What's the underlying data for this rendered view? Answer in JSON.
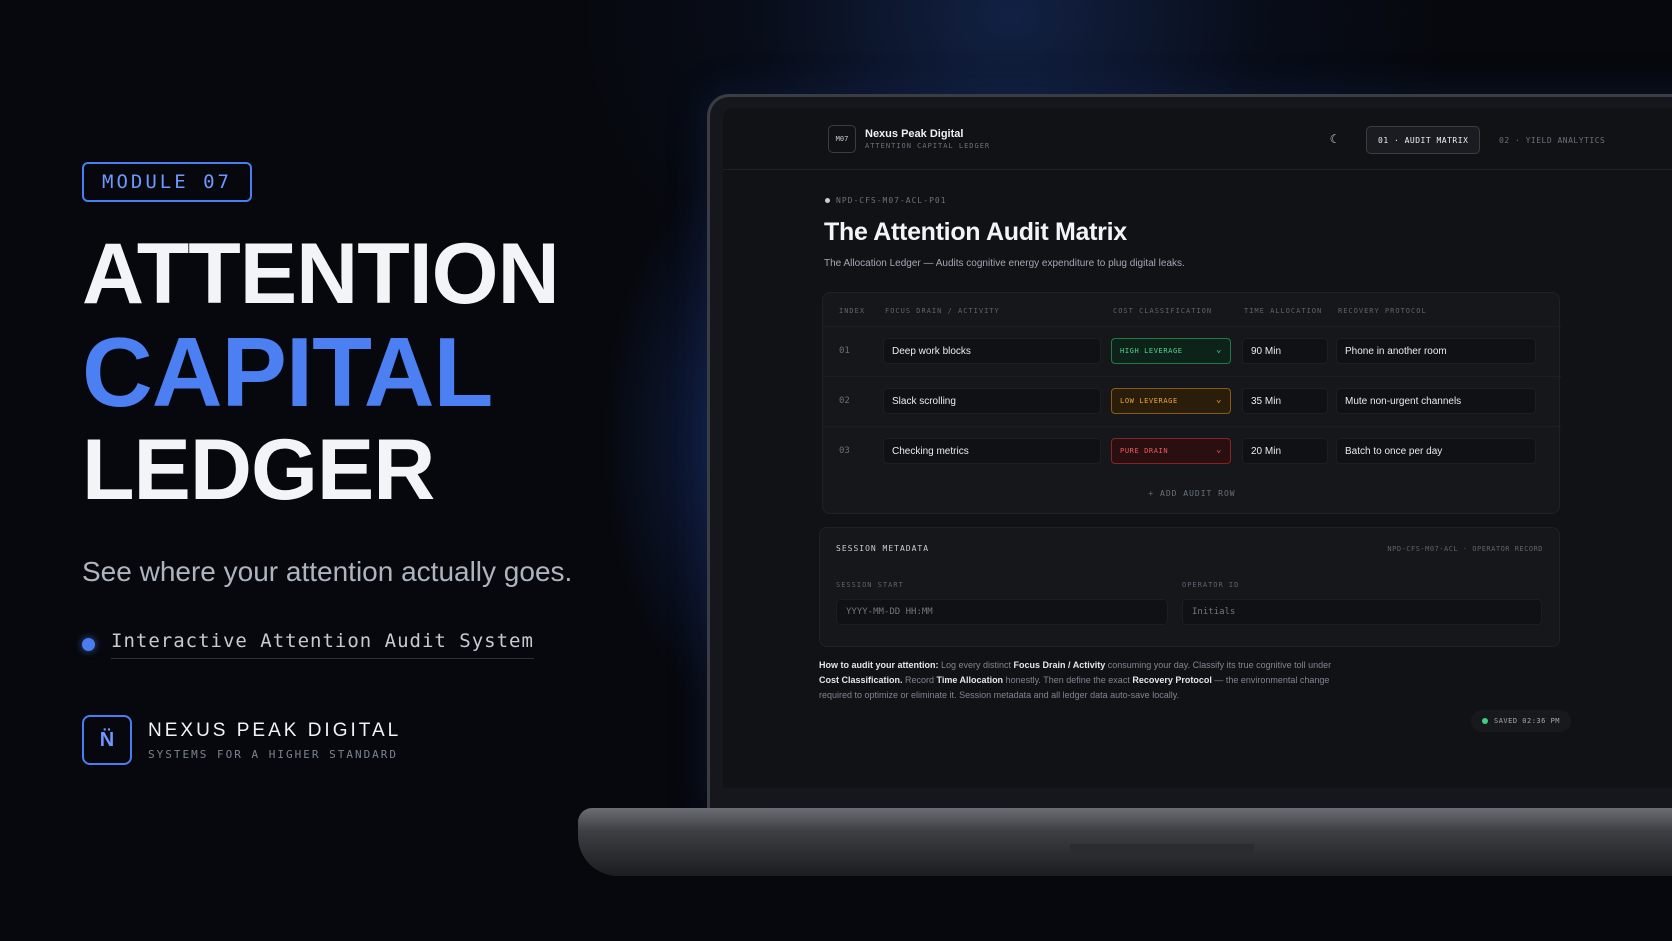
{
  "hero": {
    "badge": "MODULE 07",
    "line1": "ATTENTION",
    "line2": "CAPITAL",
    "line3": "LEDGER",
    "tagline": "See where your attention actually goes.",
    "feature": "Interactive Attention Audit System",
    "brand_logo": "N̈",
    "brand_name": "NEXUS PEAK DIGITAL",
    "brand_sub": "SYSTEMS FOR A HIGHER STANDARD"
  },
  "app": {
    "logo": "M07",
    "title": "Nexus Peak Digital",
    "subtitle": "ATTENTION CAPITAL LEDGER",
    "theme_icon": "moon-icon",
    "tabs": [
      {
        "label": "01 · AUDIT MATRIX"
      },
      {
        "label": "02 · YIELD ANALYTICS"
      }
    ],
    "doc_code": "NPD-CFS-M07-ACL-P01",
    "page_title": "The Attention Audit Matrix",
    "page_desc": "The Allocation Ledger — Audits cognitive energy expenditure to plug digital leaks."
  },
  "matrix": {
    "columns": [
      "INDEX",
      "FOCUS DRAIN / ACTIVITY",
      "COST CLASSIFICATION",
      "TIME ALLOCATION",
      "RECOVERY PROTOCOL"
    ],
    "rows": [
      {
        "index": "01",
        "activity": "Deep work blocks",
        "classification": "HIGH LEVERAGE",
        "time": "90 Min",
        "recovery": "Phone in another room"
      },
      {
        "index": "02",
        "activity": "Slack scrolling",
        "classification": "LOW LEVERAGE",
        "time": "35 Min",
        "recovery": "Mute non-urgent channels"
      },
      {
        "index": "03",
        "activity": "Checking metrics",
        "classification": "PURE DRAIN",
        "time": "20 Min",
        "recovery": "Batch to once per day"
      }
    ],
    "add_row": "+ ADD AUDIT ROW"
  },
  "meta": {
    "title": "SESSION METADATA",
    "code": "NPD-CFS-M07-ACL · OPERATOR RECORD",
    "session_label": "SESSION START",
    "session_placeholder": "YYYY-MM-DD HH:MM",
    "operator_label": "OPERATOR ID",
    "operator_placeholder": "Initials"
  },
  "help": {
    "p1": "How to audit your attention:",
    "p2": " Log every distinct ",
    "p3": "Focus Drain / Activity",
    "p4": " consuming your day. Classify its true cognitive toll under ",
    "p5": "Cost Classification.",
    "p6": " Record ",
    "p7": "Time Allocation",
    "p8": " honestly. Then define the exact ",
    "p9": "Recovery Protocol",
    "p10": " — the environmental change required to optimize or eliminate it. Session metadata and all ledger data auto-save locally."
  },
  "status": {
    "saved": "SAVED 02:36 PM"
  },
  "colors": {
    "accent": "#4b7ff2",
    "high": "#4fd68c",
    "low": "#f0a43a",
    "drain": "#ee5a5a"
  }
}
